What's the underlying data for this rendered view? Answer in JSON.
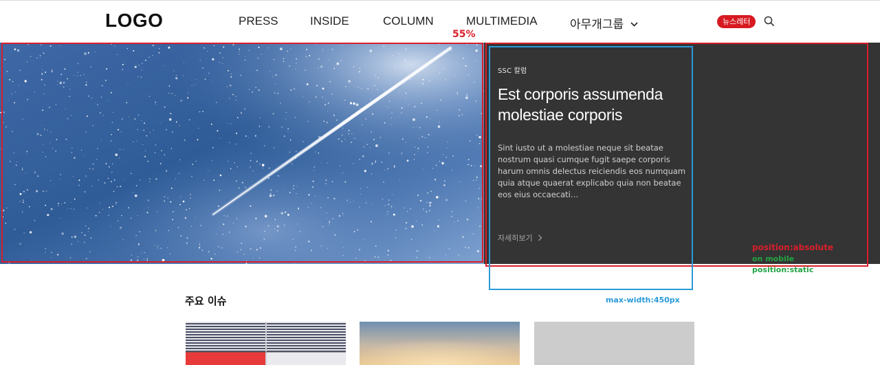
{
  "header": {
    "logo": "LOGO",
    "nav": [
      {
        "label": "PRESS"
      },
      {
        "label": "INSIDE"
      },
      {
        "label": "COLUMN"
      },
      {
        "label": "MULTIMEDIA"
      },
      {
        "label": "아무개그룹"
      }
    ],
    "newsletter_label": "뉴스레터",
    "icons": {
      "search": "search-icon",
      "dropdown": "chevron-down-icon"
    }
  },
  "hero": {
    "category": "SSC 칼럼",
    "title": "Est corporis assumenda molestiae corporis",
    "description": "Sint iusto ut a molestiae neque sit beatae nostrum quasi cumque fugit saepe corporis harum omnis delectus reiciendis eos numquam quia atque quaerat explicabo quia non beatae eos eius occaecati…",
    "more_label": "자세히보기"
  },
  "annotations": {
    "width_pct": "55%",
    "position_absolute": "position:absolute",
    "on_mobile": "on mobile",
    "position_static": "position:static",
    "max_width": "max-width:450px"
  },
  "section": {
    "title": "주요 이슈"
  },
  "colors": {
    "accent_red": "#d71920",
    "panel_bg": "#343434",
    "annotation_red": "#d81f2a",
    "annotation_green": "#22a443",
    "annotation_blue": "#2a9ad9"
  }
}
